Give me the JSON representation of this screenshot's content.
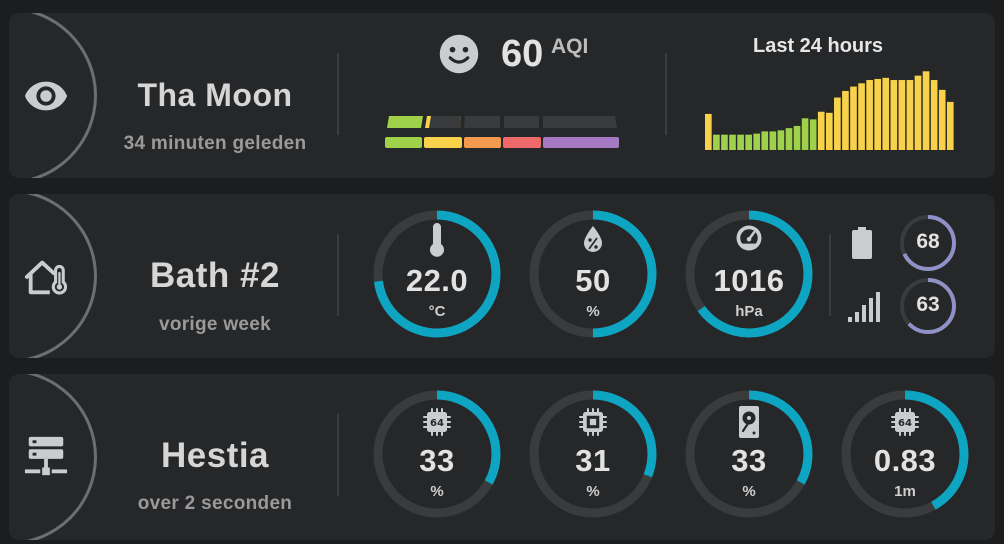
{
  "colors": {
    "background": "#1c1d1f",
    "card": "#262729",
    "gauge_track": "#3a3b3d",
    "gauge_fill": "#0ea5c2",
    "mini_fill": "#8f91c7",
    "icon": "#c9cdd0",
    "bar_green": "#9fd14b",
    "bar_yellow": "#f7d24a"
  },
  "air": {
    "icon": "eye-icon",
    "name": "Tha Moon",
    "time": "34 minuten geleden",
    "aqi_value": "60",
    "aqi_unit": "AQI",
    "aqi_icon": "smiley-face-icon",
    "scale_colors": [
      "#9fd14b",
      "#f7d24a",
      "#f39a4e",
      "#ee6a6a",
      "#a57ac3"
    ],
    "history_title": "Last 24 hours",
    "history_values": [
      33,
      14,
      14,
      14,
      14,
      14,
      15,
      17,
      17,
      18,
      20,
      22,
      29,
      28,
      35,
      34,
      48,
      54,
      58,
      61,
      64,
      65,
      66,
      64,
      64,
      64,
      68,
      72,
      64,
      55,
      44
    ]
  },
  "bath": {
    "icon": "home-thermometer-icon",
    "name": "Bath #2",
    "time": "vorige week",
    "gauges": [
      {
        "icon": "thermometer-icon",
        "value": "22.0",
        "unit": "°C",
        "level": 0.73
      },
      {
        "icon": "water-percent-icon",
        "value": "50",
        "unit": "%",
        "level": 0.5
      },
      {
        "icon": "gauge-icon",
        "value": "1016",
        "unit": "hPa",
        "level": 0.65
      }
    ],
    "battery": {
      "icon": "battery-icon",
      "value": "68",
      "level": 0.68
    },
    "signal": {
      "icon": "signal-icon",
      "value": "63",
      "level": 0.63
    }
  },
  "server": {
    "icon": "server-network-icon",
    "name": "Hestia",
    "time": "over 2 seconden",
    "gauges": [
      {
        "icon": "cpu-64-bit-icon",
        "value": "33",
        "unit": "%",
        "level": 0.33
      },
      {
        "icon": "memory-chip-icon",
        "value": "31",
        "unit": "%",
        "level": 0.31
      },
      {
        "icon": "harddisk-icon",
        "value": "33",
        "unit": "%",
        "level": 0.33
      },
      {
        "icon": "cpu-64-bit-icon",
        "value": "0.83",
        "unit": "1m",
        "level": 0.42
      }
    ]
  }
}
